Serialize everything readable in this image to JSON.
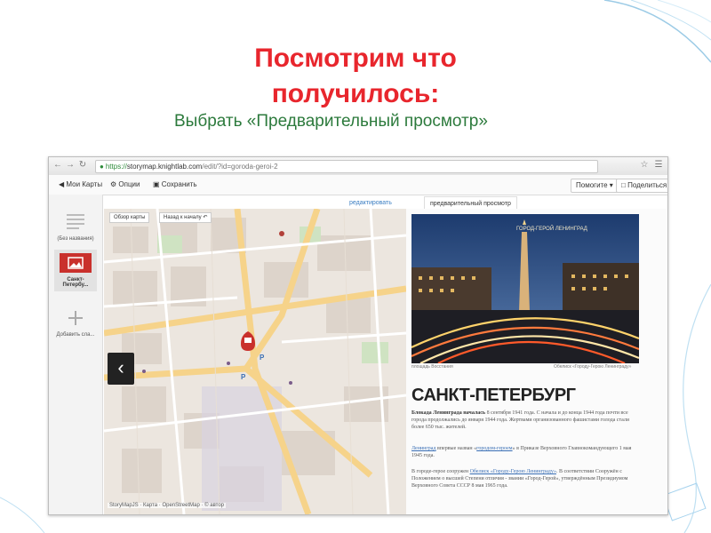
{
  "slide": {
    "title_line1": "Посмотрим что",
    "title_line2": "получилось:",
    "subtitle": "Выбрать «Предварительный просмотр»"
  },
  "browser": {
    "url_https": "https://",
    "url_host": "storymap.knightlab.com",
    "url_path": "/edit/?id=goroda-geroi-2"
  },
  "toolbar": {
    "my_maps": "Мои Карты",
    "options": "Опции",
    "save": "Сохранить",
    "help": "Помогите",
    "share": "Поделиться"
  },
  "tabs": {
    "edit": "редактировать",
    "preview": "предварительный просмотр"
  },
  "sidebar": {
    "items": [
      {
        "label": "(Без названия)"
      },
      {
        "label": "Санкт-Петербу..."
      },
      {
        "label": "Добавить сла..."
      }
    ]
  },
  "map": {
    "overview": "Обзор карты",
    "back_to_start": "Назад к началу",
    "attribution": "StoryMapJS · Картa · OpenStreetMap · © автор"
  },
  "story": {
    "caption_left": "площадь Восстания",
    "caption_right": "Обелиск «Городу-Герою Ленинграду»",
    "photo_banner": "ГОРОД-ГЕРОЙ ЛЕНИНГРАД",
    "heading": "САНКТ-ПЕТЕРБУРГ",
    "p1_lead": "Блокада Ленинграда началась",
    "p1_rest": " 8 сентября 1941 года. С начала и до конца 1944 года почти все города продолжались до января 1944 года. Жертвами организованного фашистами голода стали более 650 тыс. жителей.",
    "p2_link": "Ленинград",
    "p2_mid": " впервые назван «",
    "p2_link2": "городом-героем",
    "p2_rest": "» в Приказе Верховного Главнокомандующего 1 мая 1945 года.",
    "p3_start": "В городе-герое сооружен ",
    "p3_link": "Обелиск «Городу-Герою Ленинграду»",
    "p3_rest": ". В соответствии Сооружён с Положением о высшей Степени отличия - звании «Город-Герой», утверждённым Президиумом Верховного Совета СССР 8 мая 1965 года."
  },
  "colors": {
    "title_red": "#e8262d",
    "subtitle_green": "#2c7a3c",
    "marker_red": "#c9302c",
    "link_blue": "#3a6fb5"
  }
}
